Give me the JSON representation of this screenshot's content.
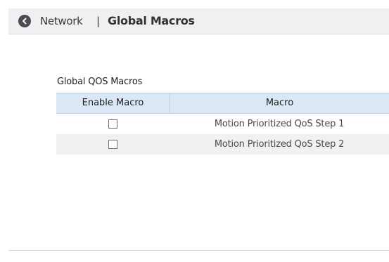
{
  "header": {
    "back_icon": "chevron-left-circle-icon",
    "parent_label": "Network",
    "separator": "|",
    "current_label": "Global Macros"
  },
  "section": {
    "title": "Global QOS Macros"
  },
  "table": {
    "columns": [
      "Enable Macro",
      "Macro"
    ],
    "rows": [
      {
        "enabled": false,
        "macro": "Motion Prioritized QoS Step 1"
      },
      {
        "enabled": false,
        "macro": "Motion Prioritized QoS Step 2"
      }
    ]
  },
  "colors": {
    "header_bg": "#eff0f2",
    "table_header_bg": "#dbe7f4",
    "alt_row_bg": "#f1f1f1"
  }
}
